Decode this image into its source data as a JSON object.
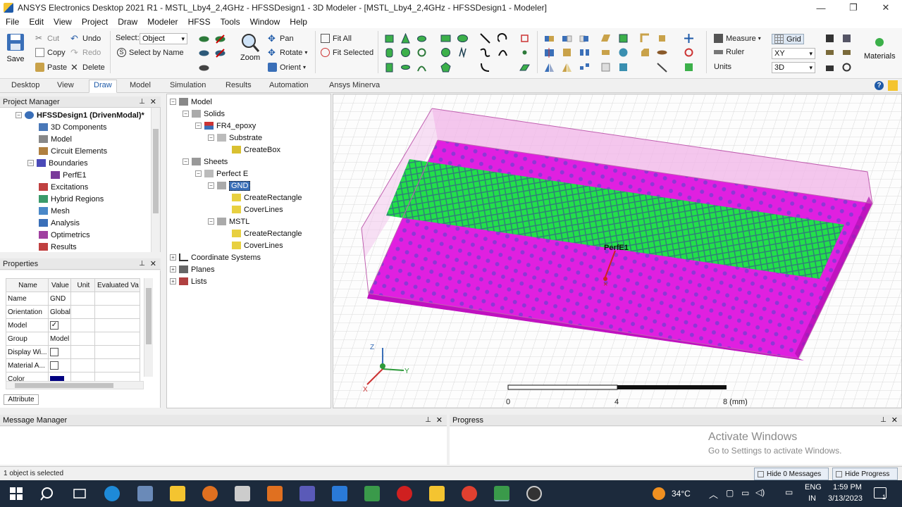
{
  "window": {
    "title": "ANSYS Electronics Desktop 2021 R1 - MSTL_Lby4_2,4GHz - HFSSDesign1 - 3D Modeler - [MSTL_Lby4_2,4GHz - HFSSDesign1 - Modeler]",
    "minimize": "—",
    "restore": "❐",
    "close": "✕"
  },
  "menu": [
    "File",
    "Edit",
    "View",
    "Project",
    "Draw",
    "Modeler",
    "HFSS",
    "Tools",
    "Window",
    "Help"
  ],
  "ribbon": {
    "save": "Save",
    "cut": "Cut",
    "copy": "Copy",
    "paste": "Paste",
    "undo": "Undo",
    "redo": "Redo",
    "delete": "Delete",
    "select_label": "Select:",
    "select_value": "Object",
    "select_by_name": "Select by Name",
    "zoom": "Zoom",
    "pan": "Pan",
    "rotate": "Rotate",
    "orient": "Orient",
    "fit_all": "Fit All",
    "fit_selected": "Fit Selected",
    "measure": "Measure",
    "ruler": "Ruler",
    "units": "Units",
    "grid": "Grid",
    "plane_value": "XY",
    "mode_value": "3D",
    "materials": "Materials"
  },
  "tabs": [
    "Desktop",
    "View",
    "Draw",
    "Model",
    "Simulation",
    "Results",
    "Automation",
    "Ansys Minerva"
  ],
  "active_tab": "Draw",
  "project_manager": {
    "title": "Project Manager",
    "design": "HFSSDesign1 (DrivenModal)*",
    "items": [
      "3D Components",
      "Model",
      "Circuit Elements",
      "Boundaries",
      "PerfE1",
      "Excitations",
      "Hybrid Regions",
      "Mesh",
      "Analysis",
      "Optimetrics",
      "Results"
    ]
  },
  "properties": {
    "title": "Properties",
    "headers": [
      "Name",
      "Value",
      "Unit",
      "Evaluated Va"
    ],
    "rows": [
      {
        "name": "Name",
        "value": "GND"
      },
      {
        "name": "Orientation",
        "value": "Global"
      },
      {
        "name": "Model",
        "value": "✓"
      },
      {
        "name": "Group",
        "value": "Model"
      },
      {
        "name": "Display Wi...",
        "value": ""
      },
      {
        "name": "Material A...",
        "value": ""
      },
      {
        "name": "Color",
        "value": ""
      }
    ],
    "tab": "Attribute"
  },
  "history_tree": {
    "model": "Model",
    "solids": "Solids",
    "material": "FR4_epoxy",
    "substrate": "Substrate",
    "create_box": "CreateBox",
    "sheets": "Sheets",
    "perfect_e": "Perfect E",
    "gnd": "GND",
    "gnd_create_rect": "CreateRectangle",
    "gnd_cover": "CoverLines",
    "mstl": "MSTL",
    "mstl_create_rect": "CreateRectangle",
    "mstl_cover": "CoverLines",
    "coord_systems": "Coordinate Systems",
    "planes": "Planes",
    "lists": "Lists"
  },
  "viewport": {
    "label_boundary": "PerfE1",
    "scale_ticks": [
      "0",
      "4",
      "8 (mm)"
    ],
    "axes": [
      "Z",
      "Y",
      "X"
    ],
    "substrate_color": "#e020e0",
    "strip_color": "#22e04a",
    "box_edge_color": "#e890d8"
  },
  "message_manager": {
    "title": "Message Manager"
  },
  "progress": {
    "title": "Progress"
  },
  "status": {
    "text": "1 object is selected",
    "hide_messages": "Hide 0 Messages",
    "hide_progress": "Hide Progress"
  },
  "watermark": {
    "line1": "Activate Windows",
    "line2": "Go to Settings to activate Windows."
  },
  "taskbar": {
    "weather": "34°C",
    "lang1": "ENG",
    "lang2": "IN",
    "time": "1:59 PM",
    "date": "3/13/2023",
    "notifications": "1"
  }
}
